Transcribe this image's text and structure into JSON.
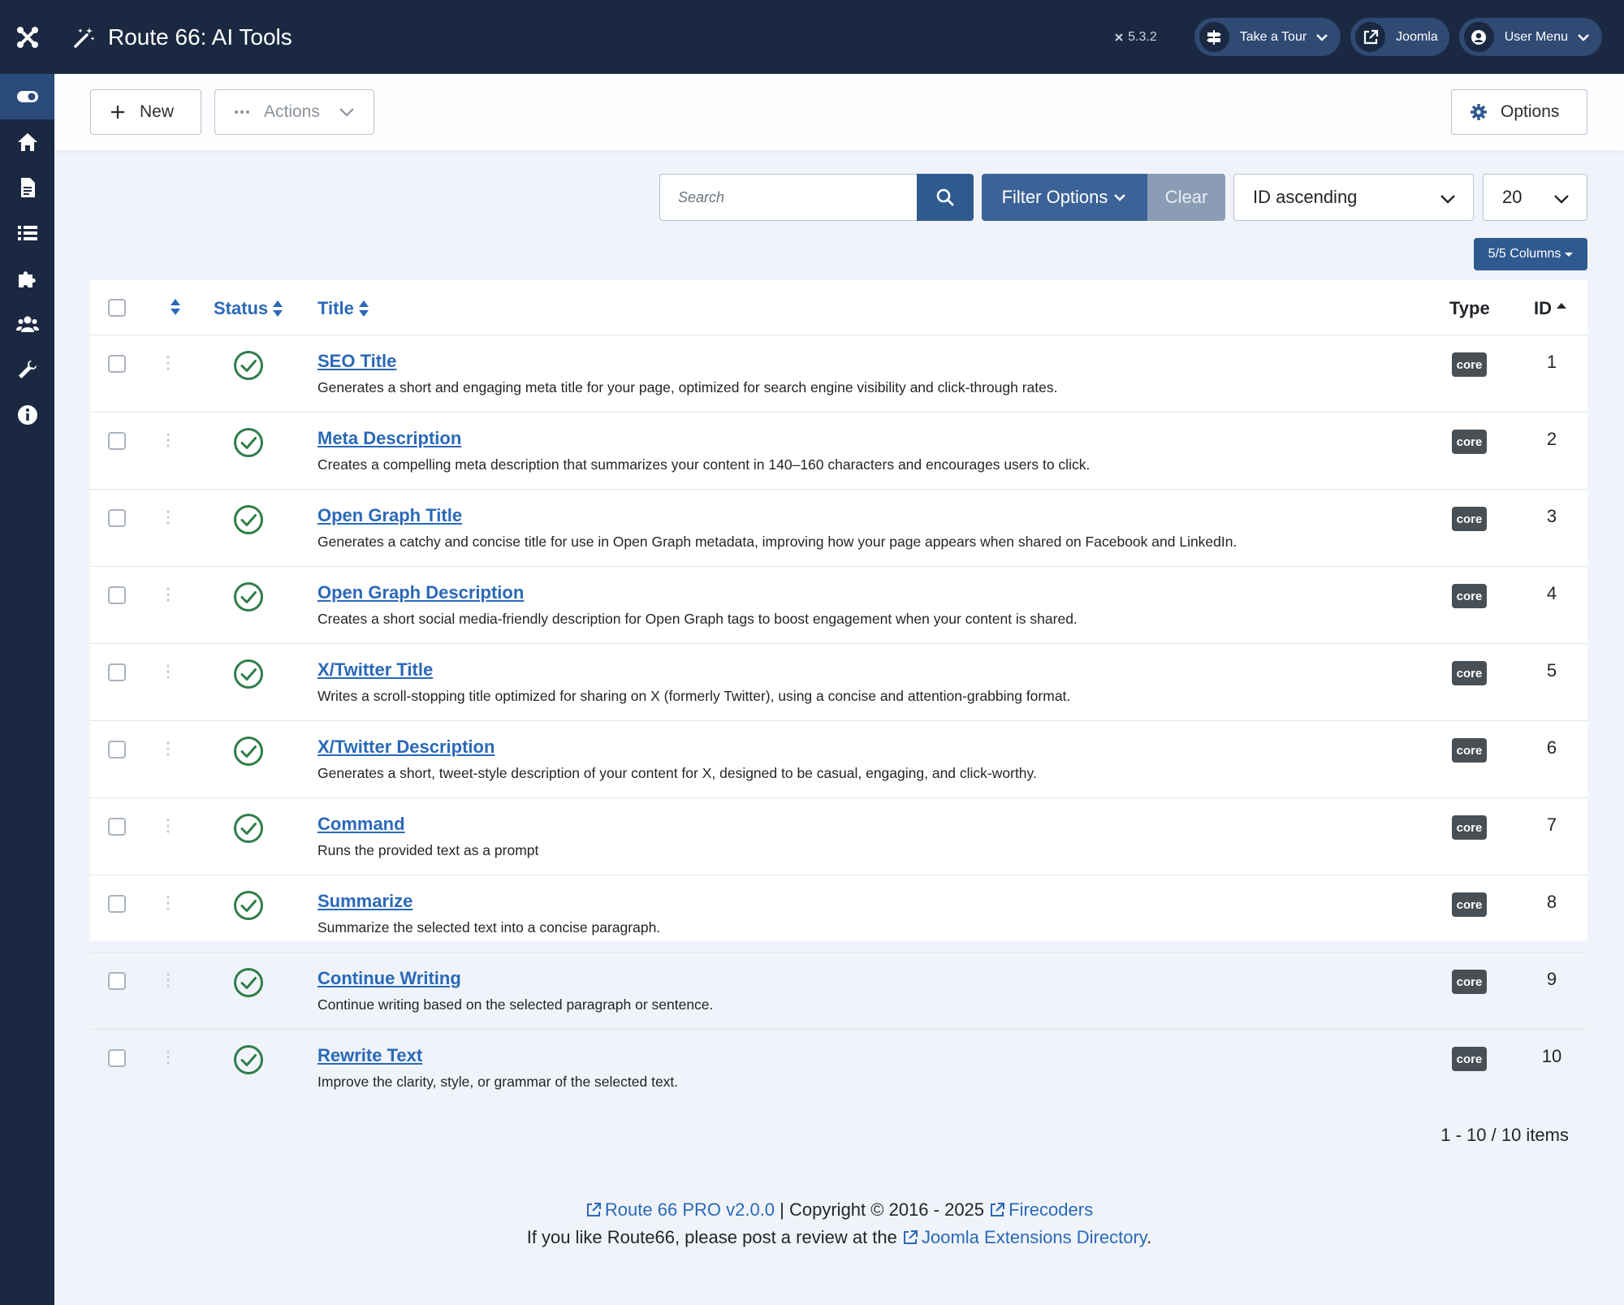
{
  "app": {
    "title": "Route 66: AI Tools",
    "version": "5.3.2"
  },
  "header": {
    "tour_label": "Take a Tour",
    "joomla_label": "Joomla",
    "user_label": "User Menu"
  },
  "toolbar": {
    "new_label": "New",
    "actions_label": "Actions",
    "options_label": "Options"
  },
  "filters": {
    "search_placeholder": "Search",
    "filter_label": "Filter Options",
    "clear_label": "Clear",
    "ordering": "ID ascending",
    "limit": "20",
    "columns_label": "5/5 Columns"
  },
  "table": {
    "headers": {
      "status": "Status",
      "title": "Title",
      "type": "Type",
      "id": "ID"
    },
    "rows": [
      {
        "title": "SEO Title",
        "description": "Generates a short and engaging meta title for your page, optimized for search engine visibility and click-through rates.",
        "type": "core",
        "id": "1"
      },
      {
        "title": "Meta Description",
        "description": "Creates a compelling meta description that summarizes your content in 140–160 characters and encourages users to click.",
        "type": "core",
        "id": "2"
      },
      {
        "title": "Open Graph Title",
        "description": "Generates a catchy and concise title for use in Open Graph metadata, improving how your page appears when shared on Facebook and LinkedIn.",
        "type": "core",
        "id": "3"
      },
      {
        "title": "Open Graph Description",
        "description": "Creates a short social media-friendly description for Open Graph tags to boost engagement when your content is shared.",
        "type": "core",
        "id": "4"
      },
      {
        "title": "X/Twitter Title",
        "description": "Writes a scroll-stopping title optimized for sharing on X (formerly Twitter), using a concise and attention-grabbing format.",
        "type": "core",
        "id": "5"
      },
      {
        "title": "X/Twitter Description",
        "description": "Generates a short, tweet-style description of your content for X, designed to be casual, engaging, and click-worthy.",
        "type": "core",
        "id": "6"
      },
      {
        "title": "Command",
        "description": "Runs the provided text as a prompt",
        "type": "core",
        "id": "7"
      },
      {
        "title": "Summarize",
        "description": "Summarize the selected text into a concise paragraph.",
        "type": "core",
        "id": "8"
      },
      {
        "title": "Continue Writing",
        "description": "Continue writing based on the selected paragraph or sentence.",
        "type": "core",
        "id": "9"
      },
      {
        "title": "Rewrite Text",
        "description": "Improve the clarity, style, or grammar of the selected text.",
        "type": "core",
        "id": "10"
      }
    ]
  },
  "pagination": {
    "summary": "1 - 10 / 10 items"
  },
  "footer": {
    "product_link": "Route 66 PRO v2.0.0",
    "copyright": "| Copyright © 2016 - 2025",
    "vendor_link": "Firecoders",
    "review_text": "If you like Route66, please post a review at the",
    "jed_link": "Joomla Extensions Directory",
    "period": "."
  },
  "colors": {
    "sidebar": "#1a2941",
    "accent": "#2a69b8",
    "success": "#2f7d4a",
    "badge": "#484f55"
  }
}
